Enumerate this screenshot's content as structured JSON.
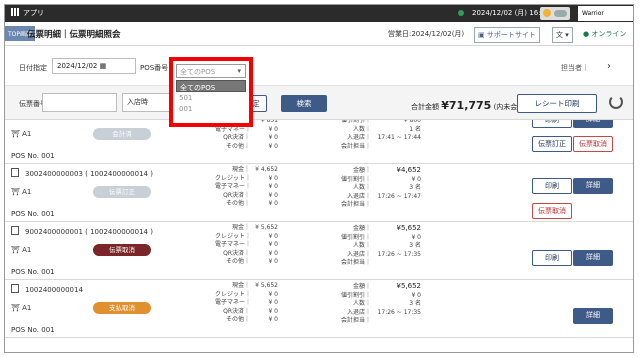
{
  "titlebar": {
    "app": "アプリ",
    "datetime": "2024/12/02 (月) 16:50",
    "logo": "Warrior"
  },
  "header": {
    "top_button": "TOP画面",
    "title": "伝票明細｜伝票明細照会",
    "business_date": "営業日:2024/12/02(月)",
    "support": "サポートサイト",
    "lang": "文",
    "online": "● オンライン"
  },
  "filter": {
    "date_label": "日付指定",
    "date_value": "2024/12/02",
    "pos_label": "POS番号",
    "assignee": "担当者｜"
  },
  "search": {
    "receipt_label": "伝票番号",
    "receipt_placeholder": "",
    "store_label": "入店時",
    "set_button": "定",
    "search_button": "検索",
    "total_label": "合計金額",
    "total_value": "¥71,775",
    "total_note": "(内未会計金額：0)",
    "print_button": "レシート印刷"
  },
  "pos_dropdown": {
    "selected": "全てのPOS",
    "options": [
      "全てのPOS",
      "501",
      "001"
    ]
  },
  "records": [
    {
      "receipt": "",
      "seat": "A1",
      "status": "会計済",
      "status_color": "#c9cfd6",
      "pos": "POS No. 001",
      "payments": [
        {
          "k": "クレジット｜",
          "v": "¥ 851"
        },
        {
          "k": "電子マネー｜",
          "v": "¥ 0"
        },
        {
          "k": "QR決済｜",
          "v": "¥ 0"
        },
        {
          "k": "その他｜",
          "v": "¥ 0"
        }
      ],
      "amounts": [
        {
          "k": "値引割引｜",
          "v": "¥ 800"
        },
        {
          "k": "人数｜",
          "v": "1 名"
        },
        {
          "k": "入退店｜",
          "v": "17:41 ~ 17:44"
        },
        {
          "k": "会計担当｜",
          "v": ""
        }
      ],
      "actions": [
        {
          "label": "印刷",
          "style": "out"
        },
        {
          "label": "詳細",
          "style": "dark"
        },
        {
          "label": "伝票訂正",
          "style": "out"
        },
        {
          "label": "伝票取消",
          "style": "red"
        }
      ]
    },
    {
      "receipt": "3002400000003 ( 1002400000014 )",
      "seat": "A1",
      "status": "伝票訂正",
      "status_color": "#c9cfd6",
      "pos": "POS No. 001",
      "payments": [
        {
          "k": "現金｜",
          "v": "¥ 4,652"
        },
        {
          "k": "クレジット｜",
          "v": "¥ 0"
        },
        {
          "k": "電子マネー｜",
          "v": "¥ 0"
        },
        {
          "k": "QR決済｜",
          "v": "¥ 0"
        },
        {
          "k": "その他｜",
          "v": "¥ 0"
        }
      ],
      "amounts": [
        {
          "k": "金額｜",
          "v": "¥4,652"
        },
        {
          "k": "値引割引｜",
          "v": "¥ 0"
        },
        {
          "k": "人数｜",
          "v": "3 名"
        },
        {
          "k": "入退店｜",
          "v": "17:26 ~ 17:47"
        },
        {
          "k": "会計担当｜",
          "v": ""
        }
      ],
      "actions": [
        {
          "label": "印刷",
          "style": "out"
        },
        {
          "label": "詳細",
          "style": "dark"
        },
        {
          "label": "伝票取消",
          "style": "red"
        }
      ]
    },
    {
      "receipt": "9002400000001 ( 1002400000014 )",
      "seat": "A1",
      "status": "伝票取消",
      "status_color": "#7a2527",
      "pos": "POS No. 001",
      "payments": [
        {
          "k": "現金｜",
          "v": "¥ 5,652"
        },
        {
          "k": "クレジット｜",
          "v": "¥ 0"
        },
        {
          "k": "電子マネー｜",
          "v": "¥ 0"
        },
        {
          "k": "QR決済｜",
          "v": "¥ 0"
        },
        {
          "k": "その他｜",
          "v": "¥ 0"
        }
      ],
      "amounts": [
        {
          "k": "金額｜",
          "v": "¥5,652"
        },
        {
          "k": "値引割引｜",
          "v": "¥ 0"
        },
        {
          "k": "人数｜",
          "v": "3 名"
        },
        {
          "k": "入退店｜",
          "v": "17:26 ~ 17:35"
        },
        {
          "k": "会計担当｜",
          "v": ""
        }
      ],
      "actions": [
        {
          "label": "印刷",
          "style": "out"
        },
        {
          "label": "詳細",
          "style": "dark"
        }
      ]
    },
    {
      "receipt": "1002400000014",
      "seat": "A1",
      "status": "支払取消",
      "status_color": "#e0902e",
      "pos": "POS No. 001",
      "payments": [
        {
          "k": "現金｜",
          "v": "¥ 5,652"
        },
        {
          "k": "クレジット｜",
          "v": "¥ 0"
        },
        {
          "k": "電子マネー｜",
          "v": "¥ 0"
        },
        {
          "k": "QR決済｜",
          "v": "¥ 0"
        },
        {
          "k": "その他｜",
          "v": "¥ 0"
        }
      ],
      "amounts": [
        {
          "k": "金額｜",
          "v": "¥5,652"
        },
        {
          "k": "値引割引｜",
          "v": "¥ 0"
        },
        {
          "k": "人数｜",
          "v": "3 名"
        },
        {
          "k": "入退店｜",
          "v": "17:26 ~ 17:35"
        },
        {
          "k": "会計担当｜",
          "v": ""
        }
      ],
      "actions": [
        {
          "label": "詳細",
          "style": "dark"
        }
      ]
    }
  ]
}
